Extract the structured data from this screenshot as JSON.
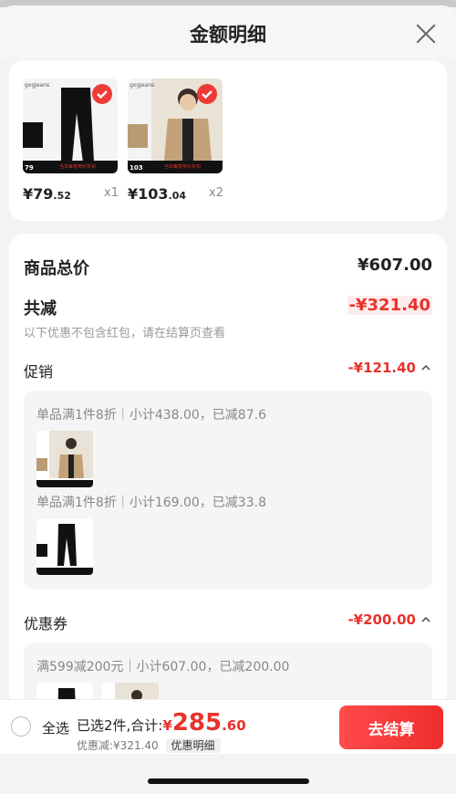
{
  "header": {
    "title": "金额明细"
  },
  "products": [
    {
      "brand": "gxgjeans",
      "price_main": "¥79",
      "price_decimal": ".52",
      "qty": "x1",
      "tag": "79",
      "banner": "当日每笔特价折扣"
    },
    {
      "brand": "gxgjeans",
      "price_main": "¥103",
      "price_decimal": ".04",
      "qty": "x2",
      "tag": "103",
      "banner": "当日每笔特价折扣"
    }
  ],
  "summary": {
    "total_label": "商品总价",
    "total_value": "¥607.00",
    "reduce_label": "共减",
    "reduce_value": "-¥321.40",
    "note": "以下优惠不包含红包，请在结算页查看"
  },
  "promotion": {
    "label": "促销",
    "value": "-¥121.40",
    "lines": [
      "单品满1件8折｜小计438.00，已减87.6",
      "单品满1件8折｜小计169.00，已减33.8"
    ]
  },
  "coupon": {
    "label": "优惠券",
    "value": "-¥200.00",
    "line": "满599减200元｜小计607.00，已减200.00"
  },
  "footer": {
    "select_all": "全选",
    "selected_text": "已选2件,合计:",
    "currency": "¥",
    "total_main": "285",
    "total_decimal": ".60",
    "discount_text": "优惠减:¥321.40",
    "detail_tag": "优惠明细",
    "checkout": "去结算"
  },
  "colors": {
    "accent": "#e8322b",
    "button": "#f03a36"
  }
}
